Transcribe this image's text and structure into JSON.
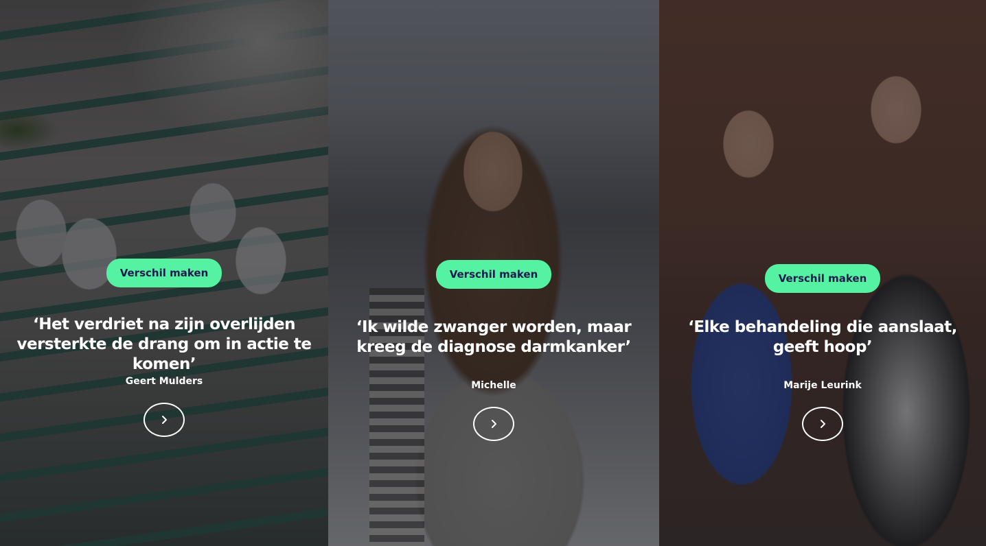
{
  "cards": [
    {
      "cta_label": "Verschil maken",
      "quote": "‘Het verdriet na zijn overlijden versterkte de drang om in actie te komen’",
      "author": "Geert Mulders",
      "arrow_icon": "chevron-right-icon"
    },
    {
      "cta_label": "Verschil maken",
      "quote": "‘Ik wilde zwanger worden, maar kreeg de diagnose darmkanker’",
      "author": "Michelle",
      "arrow_icon": "chevron-right-icon"
    },
    {
      "cta_label": "Verschil maken",
      "quote": "‘Elke behandeling die aanslaat, geeft hoop’",
      "author": "Marije Leurink",
      "arrow_icon": "chevron-right-icon"
    }
  ],
  "colors": {
    "cta_background": "#55f2a1",
    "cta_text": "#1b1b4f",
    "text": "#ffffff"
  }
}
